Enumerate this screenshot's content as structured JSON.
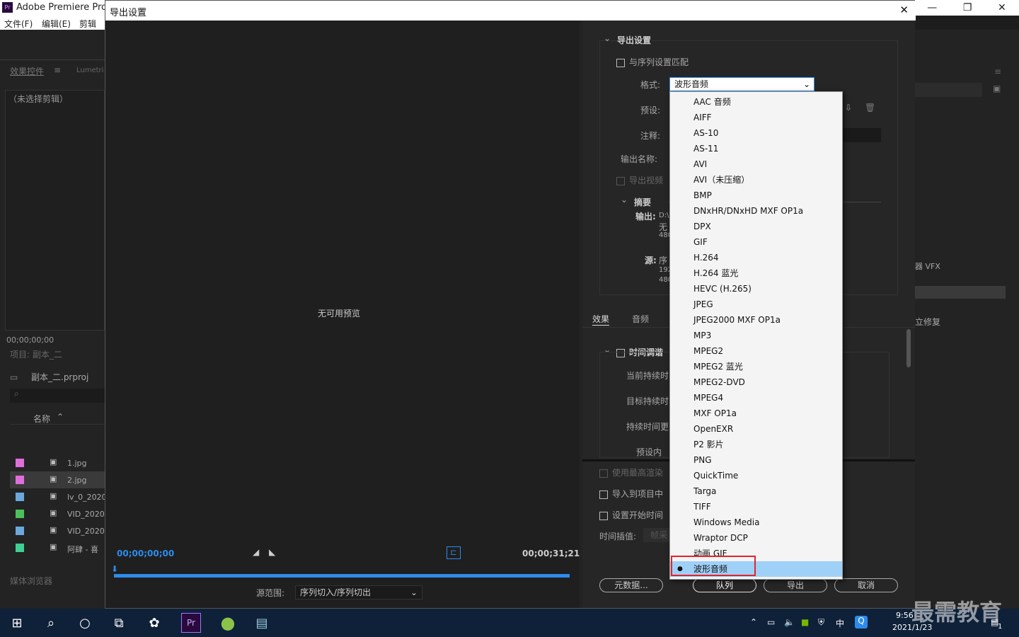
{
  "app": {
    "title": "Adobe Premiere Pro",
    "icon": "Pr",
    "menu": [
      "文件(F)",
      "编辑(E)",
      "剪辑(C"
    ]
  },
  "window_controls": {
    "minimize": "—",
    "maximize": "❐",
    "close": "✕"
  },
  "left_panel": {
    "tab_effects": "效果控件",
    "tab_lumetri": "Lumetri",
    "no_clip": "（未选择剪辑）",
    "timecode": "00;00;00;00",
    "project": "项目: 副本_二",
    "proj_file": "副本_二.prproj",
    "col_name": "名称",
    "items": [
      {
        "name": "1.jpg",
        "color": "#e06ddc"
      },
      {
        "name": "2.jpg",
        "color": "#e06ddc"
      },
      {
        "name": "lv_0_2020",
        "color": "#6ca8dc"
      },
      {
        "name": "VID_20201",
        "color": "#4cc15a"
      },
      {
        "name": "VID_20201",
        "color": "#6ca8dc"
      },
      {
        "name": "阿肆 - 喜",
        "color": "#3fcf91"
      }
    ],
    "media_browser": "媒体浏览器"
  },
  "right_panel": {
    "vfx": "器 VFX",
    "repair": "立修复"
  },
  "dialog": {
    "title": "导出设置",
    "close": "✕",
    "no_preview": "无可用预览",
    "tc_in": "00;00;00;00",
    "tc_out": "00;00;31;21",
    "source_range_label": "源范围:",
    "source_range_value": "序列切入/序列切出"
  },
  "settings": {
    "section": "导出设置",
    "match_seq": "与序列设置匹配",
    "format_label": "格式:",
    "format_value": "波形音频",
    "preset_label": "预设:",
    "comment_label": "注释:",
    "output_name_label": "输出名称:",
    "export_video": "导出视频",
    "summary": "摘要",
    "output_label": "输出:",
    "output_val": [
      "D:\\",
      "无",
      "480"
    ],
    "source_label": "源:",
    "source_val": [
      "序",
      "192",
      "480"
    ],
    "tab_effects": "效果",
    "tab_audio": "音频",
    "time_tuning": "时间调谐",
    "current_dur": "当前持续时",
    "target_dur": "目标持续时",
    "dur_change": "持续时间更",
    "preset_in": "预设内",
    "use_max_render": "使用最高渲染",
    "import_project": "导入到项目中",
    "set_start_tc": "设置开始时间",
    "interp_label": "时间插值:",
    "interp_value": "帧采",
    "btn_metadata": "元数据...",
    "btn_queue": "队列",
    "btn_export": "导出",
    "btn_cancel": "取消"
  },
  "format_options": [
    "AAC 音频",
    "AIFF",
    "AS-10",
    "AS-11",
    "AVI",
    "AVI（未压缩）",
    "BMP",
    "DNxHR/DNxHD MXF OP1a",
    "DPX",
    "GIF",
    "H.264",
    "H.264 蓝光",
    "HEVC (H.265)",
    "JPEG",
    "JPEG2000 MXF OP1a",
    "MP3",
    "MPEG2",
    "MPEG2 蓝光",
    "MPEG2-DVD",
    "MPEG4",
    "MXF OP1a",
    "OpenEXR",
    "P2 影片",
    "PNG",
    "QuickTime",
    "Targa",
    "TIFF",
    "Windows Media",
    "Wraptor DCP",
    "动画 GIF",
    "波形音频"
  ],
  "selected_marker": "●",
  "taskbar": {
    "time": "9:56",
    "date": "2021/1/23",
    "ime": "中",
    "notif": "1",
    "watermark": "最需教育"
  },
  "colors": {
    "accent_blue": "#2d8ceb",
    "highlight_red": "#e0252b",
    "selected_bg": "#9fd0f7"
  }
}
